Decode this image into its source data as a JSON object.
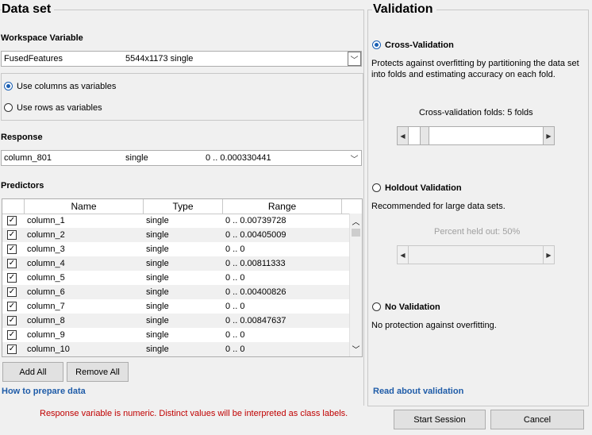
{
  "dataset": {
    "title": "Data set",
    "workspace_label": "Workspace Variable",
    "workspace_combo": {
      "name": "FusedFeatures",
      "info": "5544x1173 single"
    },
    "use_columns": "Use columns as variables",
    "use_rows": "Use rows as variables",
    "response_label": "Response",
    "response_combo": {
      "name": "column_801",
      "type": "single",
      "range": "0 .. 0.000330441"
    },
    "predictors_label": "Predictors",
    "columns": {
      "name": "Name",
      "type": "Type",
      "range": "Range"
    },
    "rows": [
      {
        "name": "column_1",
        "type": "single",
        "range": "0 .. 0.00739728"
      },
      {
        "name": "column_2",
        "type": "single",
        "range": "0 .. 0.00405009"
      },
      {
        "name": "column_3",
        "type": "single",
        "range": "0 .. 0"
      },
      {
        "name": "column_4",
        "type": "single",
        "range": "0 .. 0.00811333"
      },
      {
        "name": "column_5",
        "type": "single",
        "range": "0 .. 0"
      },
      {
        "name": "column_6",
        "type": "single",
        "range": "0 .. 0.00400826"
      },
      {
        "name": "column_7",
        "type": "single",
        "range": "0 .. 0"
      },
      {
        "name": "column_8",
        "type": "single",
        "range": "0 .. 0.00847637"
      },
      {
        "name": "column_9",
        "type": "single",
        "range": "0 .. 0"
      },
      {
        "name": "column_10",
        "type": "single",
        "range": "0 .. 0"
      }
    ],
    "add_all": "Add All",
    "remove_all": "Remove All",
    "help_link": "How to prepare data",
    "warning": "Response variable is numeric. Distinct values will be interpreted as class labels."
  },
  "validation": {
    "title": "Validation",
    "cross": {
      "label": "Cross-Validation",
      "desc1": "Protects against overfitting by partitioning the data set",
      "desc2": "into folds and estimating accuracy on each fold.",
      "folds_label": "Cross-validation folds: 5 folds",
      "folds": 5
    },
    "holdout": {
      "label": "Holdout Validation",
      "desc": "Recommended for large data sets.",
      "percent_label": "Percent held out: 50%",
      "percent": 50
    },
    "none": {
      "label": "No Validation",
      "desc": "No protection against overfitting."
    },
    "help_link": "Read about validation"
  },
  "actions": {
    "start": "Start Session",
    "cancel": "Cancel"
  },
  "colors": {
    "link": "#1f5ca8",
    "warning": "#c00000",
    "accent": "#1a5fb4"
  }
}
